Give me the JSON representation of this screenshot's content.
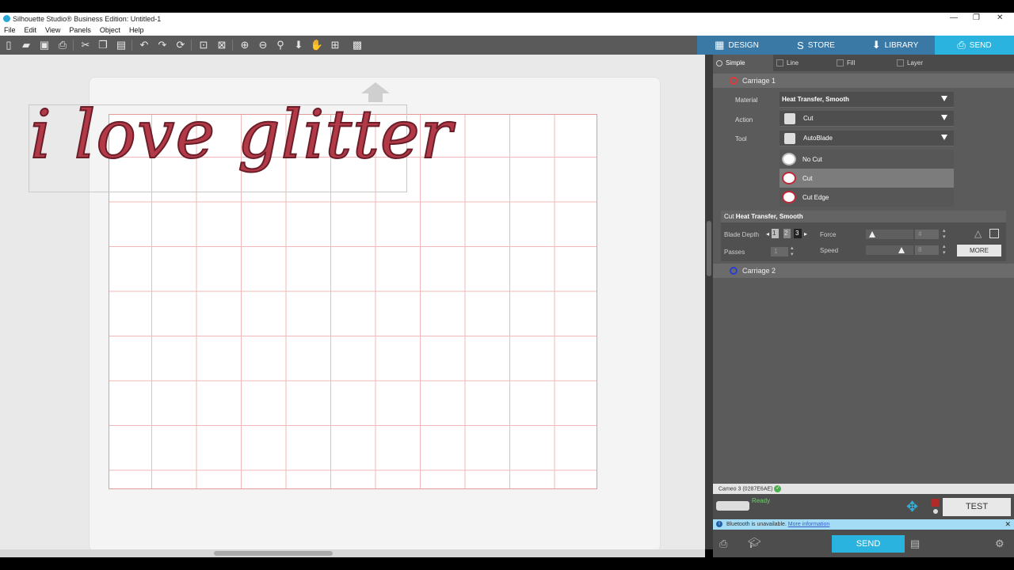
{
  "window": {
    "title": "Silhouette Studio® Business Edition: Untitled-1",
    "controls": [
      "—",
      "❐",
      "✕"
    ]
  },
  "menu": [
    "File",
    "Edit",
    "View",
    "Panels",
    "Object",
    "Help"
  ],
  "tabs": [
    {
      "label": "DESIGN",
      "icon": "▦"
    },
    {
      "label": "STORE",
      "icon": "S"
    },
    {
      "label": "LIBRARY",
      "icon": "⬇"
    },
    {
      "label": "SEND",
      "icon": "⎙"
    }
  ],
  "subtabs": [
    "Simple",
    "Line",
    "Fill",
    "Layer"
  ],
  "design_text": "i love glitter",
  "carriage1": {
    "label": "Carriage 1",
    "ring_color": "#e03a3a",
    "material_label": "Material",
    "material_value": "Heat Transfer, Smooth",
    "action_label": "Action",
    "action_value": "Cut",
    "tool_label": "Tool",
    "tool_value": "AutoBlade",
    "options": [
      "No Cut",
      "Cut",
      "Cut Edge"
    ],
    "selected_option": "Cut"
  },
  "cut_settings": {
    "header_prefix": "Cut",
    "header_material": "Heat Transfer, Smooth",
    "blade_depth_label": "Blade Depth",
    "blade_depth_values": [
      "1",
      "2",
      "3"
    ],
    "force_label": "Force",
    "force_value": "4",
    "passes_label": "Passes",
    "passes_value": "1",
    "speed_label": "Speed",
    "speed_value": "8",
    "more_label": "MORE"
  },
  "carriage2": {
    "label": "Carriage 2",
    "ring_color": "#2a3fd0"
  },
  "device": {
    "name": "Cameo 3 (0287E6AE)",
    "status": "Ready"
  },
  "test_label": "TEST",
  "bluetooth": {
    "message": "Bluetooth is unavailable.",
    "link": "More information"
  },
  "send_label": "SEND",
  "colors": {
    "send_accent": "#29b3de",
    "tab_bar": "#3a78a6",
    "design_fill": "#b23a48"
  }
}
